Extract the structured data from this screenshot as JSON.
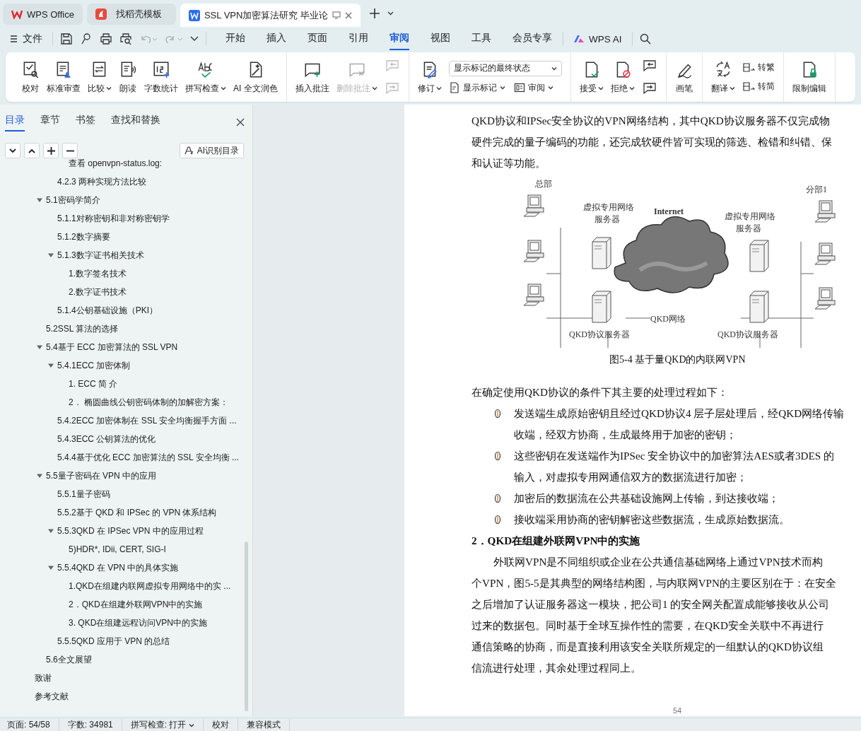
{
  "tabs": [
    {
      "label": "WPS Office",
      "kind": "wps",
      "selected": false
    },
    {
      "label": "找稻壳模板",
      "kind": "template",
      "selected": false
    },
    {
      "label": "SSL VPN加密算法研究 毕业论",
      "kind": "doc",
      "selected": true
    }
  ],
  "menu": {
    "file": "文件",
    "tabs": [
      {
        "label": "开始",
        "selected": false
      },
      {
        "label": "插入",
        "selected": false
      },
      {
        "label": "页面",
        "selected": false
      },
      {
        "label": "引用",
        "selected": false
      },
      {
        "label": "审阅",
        "selected": true
      },
      {
        "label": "视图",
        "selected": false
      },
      {
        "label": "工具",
        "selected": false
      },
      {
        "label": "会员专享",
        "selected": false
      }
    ],
    "ai": "WPS AI"
  },
  "ribbon": {
    "groups": [
      [
        {
          "kind": "large",
          "label": "校对"
        },
        {
          "kind": "large",
          "label": "标准审查"
        },
        {
          "kind": "large",
          "label": "比较",
          "caret": true
        },
        {
          "kind": "large",
          "label": "朗读"
        },
        {
          "kind": "large",
          "label": "字数统计"
        },
        {
          "kind": "large",
          "label": "拼写检查",
          "caret": true
        },
        {
          "kind": "large",
          "label": "AI 全文润色"
        }
      ],
      [
        {
          "kind": "large",
          "label": "插入批注"
        },
        {
          "kind": "large",
          "label": "删除批注",
          "caret": true,
          "disabled": true
        },
        {
          "kind": "icon-pair",
          "disabled": true
        }
      ],
      [
        {
          "kind": "large",
          "label": "修订",
          "caret": true
        },
        {
          "kind": "combo",
          "value": "显示标记的最终状态",
          "buttons": [
            {
              "label": "显示标记",
              "caret": true
            },
            {
              "label": "审阅",
              "caret": true
            }
          ]
        }
      ],
      [
        {
          "kind": "large",
          "label": "接受",
          "caret": true
        },
        {
          "kind": "large",
          "label": "拒绝",
          "caret": true
        },
        {
          "kind": "icon-pair",
          "disabled": false
        }
      ],
      [
        {
          "kind": "large",
          "label": "画笔"
        }
      ],
      [
        {
          "kind": "large",
          "label": "翻译",
          "caret": true
        },
        {
          "kind": "stack",
          "buttons": [
            {
              "label": "转繁"
            },
            {
              "label": "转简"
            }
          ]
        }
      ],
      [
        {
          "kind": "large",
          "label": "限制编辑"
        }
      ]
    ]
  },
  "sidebar": {
    "tabs": [
      {
        "label": "目录",
        "selected": true
      },
      {
        "label": "章节",
        "selected": false
      },
      {
        "label": "书签",
        "selected": false
      },
      {
        "label": "查找和替换",
        "selected": false
      }
    ],
    "ai_button": "AI识别目录",
    "toc": [
      {
        "children": [
          {
            "children": [
              {
                "children": [
                  {
                    "label": "查看 openvpn-status.log:"
                  }
                ]
              },
              {
                "label": "4.2.3 两种实现方法比较"
              }
            ]
          }
        ]
      },
      {
        "children": [
          {
            "label": "5.1密码学简介",
            "expanded": true,
            "children": [
              {
                "label": "5.1.1对称密钥和非对称密钥学"
              },
              {
                "label": "5.1.2数字摘要"
              },
              {
                "label": "5.1.3数字证书相关技术",
                "expanded": true,
                "children": [
                  {
                    "label": "1.数字签名技术"
                  },
                  {
                    "label": "2.数字证书技术"
                  }
                ]
              },
              {
                "label": "5.1.4公钥基础设施（PKI）"
              }
            ]
          },
          {
            "label": "5.2SSL 算法的选择"
          },
          {
            "label": "5.4基于 ECC 加密算法的 SSL VPN",
            "expanded": true,
            "children": [
              {
                "label": "5.4.1ECC 加密体制",
                "expanded": true,
                "children": [
                  {
                    "label": "1. ECC 简 介"
                  },
                  {
                    "label": "2．  椭圆曲线公钥密码体制的加解密方案："
                  }
                ]
              },
              {
                "label": "5.4.2ECC 加密体制在 SSL 安全均衡握手方面 ..."
              },
              {
                "label": "5.4.3ECC 公钥算法的优化"
              },
              {
                "label": "5.4.4基于优化 ECC 加密算法的 SSL 安全均衡 ..."
              }
            ]
          },
          {
            "label": "5.5量子密码在 VPN 中的应用",
            "expanded": true,
            "children": [
              {
                "label": "5.5.1量子密码"
              },
              {
                "label": "5.5.2基于 QKD 和 IPSec 的 VPN 体系结构"
              },
              {
                "label": "5.5.3QKD 在 IPSec VPN 中的应用过程",
                "expanded": true,
                "children": [
                  {
                    "label": "5)HDR*, IDii, CERT, SIG-I"
                  }
                ]
              },
              {
                "label": "5.5.4QKD 在 VPN 中的具体实施",
                "expanded": true,
                "children": [
                  {
                    "label": "1.QKD在组建内联网虚拟专用网络中的实 ..."
                  },
                  {
                    "label": "2．QKD在组建外联网VPN中的实施"
                  },
                  {
                    "label": "3. QKD在组建远程访问VPN中的实施"
                  }
                ]
              },
              {
                "label": "5.5.5QKD 应用于 VPN 的总结"
              }
            ]
          },
          {
            "label": "5.6全文展望"
          }
        ]
      },
      {
        "label": "致谢"
      },
      {
        "label": "参考文献"
      }
    ]
  },
  "document": {
    "blocks": [
      {
        "kind": "para",
        "lines": [
          "QKD协议和IPSec安全协议的VPN网络结构，其中QKD协议服务器不仅完成物",
          "硬件完成的量子编码的功能，还完成软硬件皆可实现的筛选、检错和纠错、保",
          "和认证等功能。"
        ]
      },
      {
        "kind": "figure",
        "hq": "总部",
        "branch": "分部1",
        "vpn_server_left": [
          "虚拟专用网络",
          "服务器"
        ],
        "internet": "Internet",
        "vpn_server_right": [
          "虚拟专用网络",
          "服务器"
        ],
        "qkd_network": "QKD网络",
        "qkd_server_left": "QKD协议服务器",
        "qkd_server_right": "QKD协议服务器",
        "caption": "图5-4 基于量QKD的内联网VPN"
      },
      {
        "kind": "para",
        "lines": [
          "在确定使用QKD协议的条件下其主要的处理过程如下："
        ]
      },
      {
        "kind": "list",
        "items": [
          {
            "lines": [
              "发送端生成原始密钥且经过QKD协议4 层子层处理后，经QKD网络传输",
              "收端，经双方协商，生成最终用于加密的密钥；"
            ]
          },
          {
            "lines": [
              "这些密钥在发送端作为IPSec 安全协议中的加密算法AES或者3DES 的",
              "输入，对虚拟专用网通信双方的数据流进行加密；"
            ]
          },
          {
            "lines": [
              "加密后的数据流在公共基础设施网上传输，到达接收端；"
            ]
          },
          {
            "lines": [
              "接收端采用协商的密钥解密这些数据流，生成原始数据流。"
            ]
          }
        ]
      },
      {
        "kind": "heading",
        "text": "2．QKD在组建外联网VPN中的实施"
      },
      {
        "kind": "para",
        "indent": true,
        "lines": [
          "外联网VPN是不同组织或企业在公共通信基础网络上通过VPN技术而构",
          "个VPN，图5-5是其典型的网络结构图，与内联网VPN的主要区别在于：在安全",
          "之后增加了认证服务器这一模块，把公司1 的安全网关配置成能够接收从公司",
          "过来的数据包。同时基于全球互操作性的需要，在QKD安全关联中不再进行",
          "通信策略的协商，而是直接利用该安全关联所规定的一组默认的QKD协议组",
          "信流进行处理，其余处理过程同上。"
        ]
      }
    ],
    "page_number": "54"
  },
  "status_bar": [
    {
      "kind": "text",
      "label": "页面: 54/58"
    },
    {
      "kind": "text",
      "label": "字数: 34981"
    },
    {
      "kind": "menu",
      "label": "拼写检查: 打开"
    },
    {
      "kind": "button",
      "label": "校对"
    },
    {
      "kind": "text",
      "label": "兼容模式"
    }
  ]
}
